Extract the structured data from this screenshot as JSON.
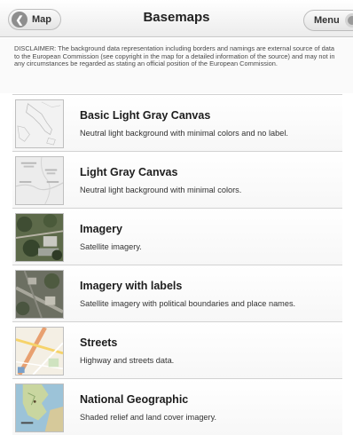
{
  "header": {
    "back_label": "Map",
    "back_icon": "chevron-left-icon",
    "title": "Basemaps",
    "menu_label": "Menu",
    "menu_icon": "gear-icon"
  },
  "disclaimer": "DISCLAIMER: The background data representation including borders and namings are external source of data to the European Commission (see copyright in the map for a detailed information of the source) and may not in any circumstances be regarded as stating an official position of the European Commission.",
  "basemaps": [
    {
      "title": "Basic Light Gray Canvas",
      "description": "Neutral light background with minimal colors and no label."
    },
    {
      "title": "Light Gray Canvas",
      "description": "Neutral light background with minimal colors."
    },
    {
      "title": "Imagery",
      "description": "Satellite imagery."
    },
    {
      "title": "Imagery with labels",
      "description": "Satellite imagery with political boundaries and place names."
    },
    {
      "title": "Streets",
      "description": "Highway and streets data."
    },
    {
      "title": "National Geographic",
      "description": "Shaded relief and land cover imagery."
    }
  ]
}
